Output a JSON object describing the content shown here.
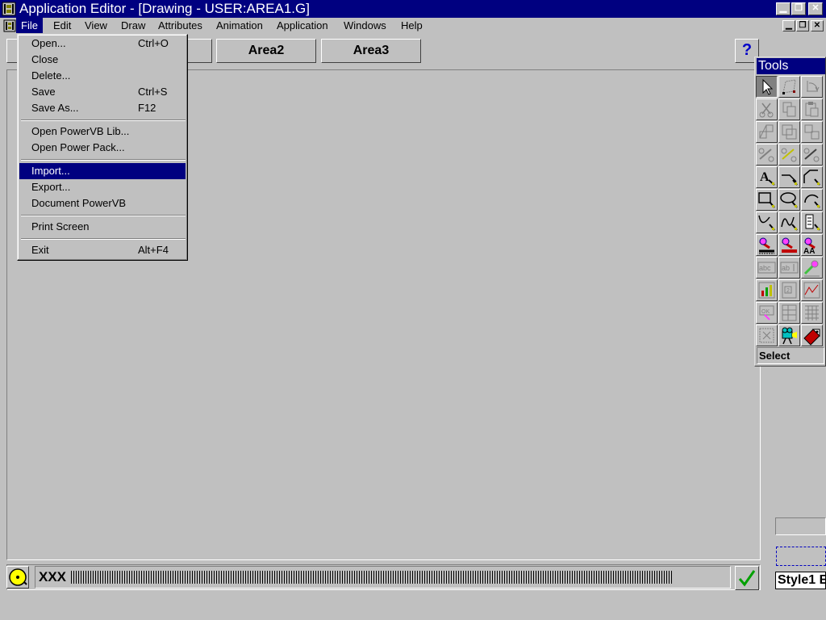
{
  "window": {
    "title": "Application Editor - [Drawing - USER:AREA1.G]"
  },
  "menubar": {
    "items": [
      {
        "label": "File"
      },
      {
        "label": "Edit"
      },
      {
        "label": "View"
      },
      {
        "label": "Draw"
      },
      {
        "label": "Attributes"
      },
      {
        "label": "Animation"
      },
      {
        "label": "Application"
      },
      {
        "label": "Windows"
      },
      {
        "label": "Help"
      }
    ]
  },
  "file_menu": {
    "items": [
      {
        "label": "Open...",
        "shortcut": "Ctrl+O"
      },
      {
        "label": "Close",
        "shortcut": ""
      },
      {
        "label": "Delete...",
        "shortcut": ""
      },
      {
        "label": "Save",
        "shortcut": "Ctrl+S"
      },
      {
        "label": "Save As...",
        "shortcut": "F12"
      },
      {
        "label": "Open PowerVB Lib...",
        "shortcut": ""
      },
      {
        "label": "Open Power Pack...",
        "shortcut": ""
      },
      {
        "label": "Import...",
        "shortcut": "",
        "highlighted": true
      },
      {
        "label": "Export...",
        "shortcut": ""
      },
      {
        "label": "Document PowerVB",
        "shortcut": ""
      },
      {
        "label": "Print Screen",
        "shortcut": ""
      },
      {
        "label": "Exit",
        "shortcut": "Alt+F4"
      }
    ]
  },
  "area_buttons": [
    {
      "label": "Area2"
    },
    {
      "label": "Area3"
    }
  ],
  "help": {
    "label": "?"
  },
  "tools_palette": {
    "title": "Tools",
    "status": "Select",
    "tools": [
      {
        "icon": "select-arrow-icon"
      },
      {
        "icon": "reshape-icon"
      },
      {
        "icon": "rotate-icon"
      },
      {
        "icon": "cut-icon"
      },
      {
        "icon": "copy-icon"
      },
      {
        "icon": "paste-icon"
      },
      {
        "icon": "group-icon"
      },
      {
        "icon": "duplicate-icon"
      },
      {
        "icon": "align-icon"
      },
      {
        "icon": "link-icon"
      },
      {
        "icon": "link-yellow-icon"
      },
      {
        "icon": "link-dark-icon"
      },
      {
        "icon": "text-tool-icon"
      },
      {
        "icon": "line-tool-icon"
      },
      {
        "icon": "polyline-tool-icon"
      },
      {
        "icon": "rectangle-tool-icon"
      },
      {
        "icon": "ellipse-tool-icon"
      },
      {
        "icon": "arc-tool-icon"
      },
      {
        "icon": "curve-tool-icon"
      },
      {
        "icon": "wave-tool-icon"
      },
      {
        "icon": "gauge-tool-icon"
      },
      {
        "icon": "line-style-icon"
      },
      {
        "icon": "fill-style-icon"
      },
      {
        "icon": "font-style-icon"
      },
      {
        "icon": "text-field-icon"
      },
      {
        "icon": "input-field-icon"
      },
      {
        "icon": "color-animate-icon"
      },
      {
        "icon": "bar-chart-icon"
      },
      {
        "icon": "list-icon"
      },
      {
        "icon": "trend-icon"
      },
      {
        "icon": "button-icon"
      },
      {
        "icon": "table-icon"
      },
      {
        "icon": "grid-icon"
      },
      {
        "icon": "symbol-icon"
      },
      {
        "icon": "camera-icon"
      },
      {
        "icon": "tag-icon"
      }
    ]
  },
  "statusbar": {
    "command": "XXX"
  },
  "style_field": {
    "text": "Style1 E"
  },
  "colors": {
    "titlebar": "#000080",
    "face": "#c0c0c0",
    "highlight": "#000080"
  }
}
